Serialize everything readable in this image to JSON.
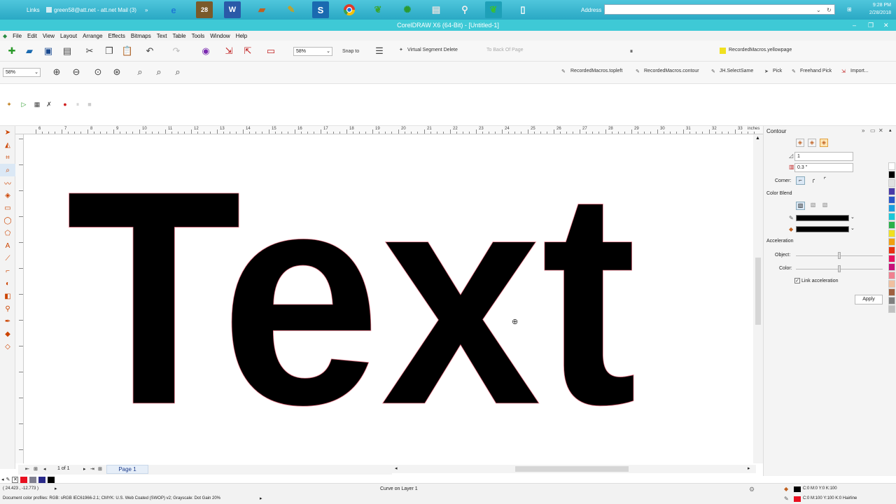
{
  "taskbar": {
    "links_label": "Links",
    "mail_label": "green58@att.net - att.net Mail (3)",
    "arrow": "»",
    "address_label": "Address",
    "clock_time": "9:28 PM",
    "clock_date": "2/28/2018",
    "icons": [
      "ie-icon",
      "calendar-icon",
      "word-icon",
      "folder-icon",
      "pencil-icon",
      "s-app-icon",
      "chrome-icon",
      "green-leaf-icon",
      "green-fan-icon",
      "printer-icon",
      "magnifier-icon",
      "leaf-icon",
      "blank-doc-icon"
    ]
  },
  "window": {
    "title": "CorelDRAW X6 (64-Bit) - [Untitled-1]"
  },
  "menu": [
    "File",
    "Edit",
    "View",
    "Layout",
    "Arrange",
    "Effects",
    "Bitmaps",
    "Text",
    "Table",
    "Tools",
    "Window",
    "Help"
  ],
  "toolbar1": {
    "zoom": "58%",
    "snap_to": "Snap to",
    "virtual_segment_delete": "Virtual Segment Delete",
    "to_back_of_page": "To Back Of Page",
    "macro_yellowpage": "RecordedMacros.yellowpage"
  },
  "toolbar2": {
    "zoom": "58%",
    "macros": [
      "RecordedMacros.topleft",
      "RecordedMacros.contour",
      "JH.SelectSame",
      "Pick",
      "Freehand Pick",
      "Import..."
    ]
  },
  "ruler": {
    "ticks": [
      "6",
      "7",
      "8",
      "9",
      "10",
      "11",
      "12",
      "13",
      "14",
      "15",
      "16",
      "17",
      "18",
      "19",
      "20",
      "21",
      "22",
      "23",
      "24",
      "25",
      "26",
      "27",
      "28",
      "29",
      "30",
      "31",
      "32",
      "33"
    ],
    "unit": "inches"
  },
  "canvas": {
    "text": "Text"
  },
  "page_nav": {
    "counter": "1 of 1",
    "page_tab": "Page 1"
  },
  "contour": {
    "title": "Contour",
    "steps": "1",
    "offset": "0.3 \"",
    "corner_label": "Corner:",
    "color_blend_label": "Color Blend",
    "acceleration_label": "Acceleration",
    "object_label": "Object:",
    "color_label": "Color:",
    "link_acceleration": "Link acceleration",
    "apply": "Apply",
    "outline_color": "#000000",
    "fill_color": "#000000"
  },
  "status": {
    "coords": "( 24.423 , -12.773 )",
    "object_info": "Curve on Layer 1",
    "color_profiles": "Document color profiles: RGB: sRGB IEC61966-2.1; CMYK: U.S. Web Coated (SWOP) v2; Grayscale: Dot Gain 20%",
    "fill_info": "C:0 M:0 Y:0 K:100",
    "outline_info": "C:0 M:100 Y:100 K:0  Hairline"
  },
  "palette_colors": [
    "#ffffff",
    "#000000",
    "#e0e0e0",
    "#4a3aa8",
    "#2a56c8",
    "#1aa0e0",
    "#18c8d8",
    "#2ab04a",
    "#f0e020",
    "#f0a010",
    "#e83010",
    "#e81060",
    "#c8107a",
    "#f08090",
    "#f0c0a0",
    "#a06040",
    "#808080",
    "#c0c0c0"
  ]
}
